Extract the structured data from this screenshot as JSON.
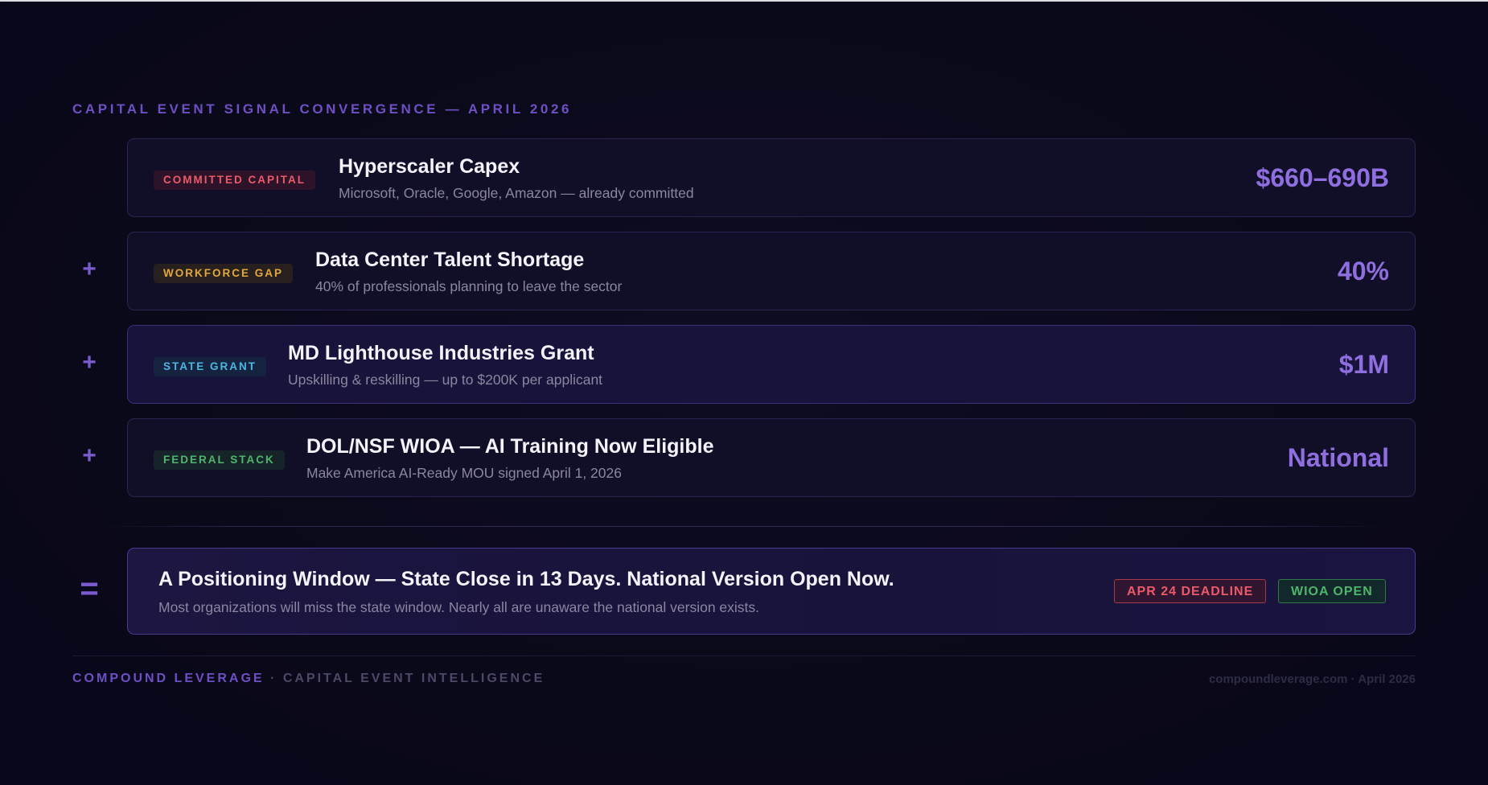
{
  "header": {
    "eyebrow": "CAPITAL EVENT SIGNAL CONVERGENCE — APRIL 2026"
  },
  "rows": [
    {
      "operator": "",
      "tag": "COMMITTED CAPITAL",
      "tag_color": "#ea5a68",
      "title": "Hyperscaler Capex",
      "subtitle": "Microsoft, Oracle, Google, Amazon — already committed",
      "value": "$660–690B"
    },
    {
      "operator": "+",
      "tag": "WORKFORCE GAP",
      "tag_color": "#e3a93a",
      "title": "Data Center Talent Shortage",
      "subtitle": "40% of professionals planning to leave the sector",
      "value": "40%"
    },
    {
      "operator": "+",
      "tag": "STATE GRANT",
      "tag_color": "#4cb6e0",
      "title": "MD Lighthouse Industries Grant",
      "subtitle": "Upskilling & reskilling — up to $200K per applicant",
      "value": "$1M"
    },
    {
      "operator": "+",
      "tag": "FEDERAL STACK",
      "tag_color": "#4fb56a",
      "title": "DOL/NSF WIOA — AI Training Now Eligible",
      "subtitle": "Make America AI-Ready MOU signed April 1, 2026",
      "value": "National"
    }
  ],
  "summary": {
    "operator": "=",
    "title": "A Positioning Window — State Close in 13 Days. National Version Open Now.",
    "subtitle": "Most organizations will miss the state window. Nearly all are unaware the national version exists.",
    "badges": [
      {
        "label": "APR 24 DEADLINE",
        "color": "#ea5a68"
      },
      {
        "label": "WIOA OPEN",
        "color": "#4fb56a"
      }
    ]
  },
  "footer": {
    "brand": "COMPOUND LEVERAGE",
    "separator": "·",
    "tagline": "CAPITAL EVENT INTELLIGENCE",
    "site_date": "compoundleverage.com · April 2026"
  },
  "colors": {
    "accent": "#7b5ccf",
    "background": "#0b0a1b",
    "value": "#8f6fe0"
  }
}
